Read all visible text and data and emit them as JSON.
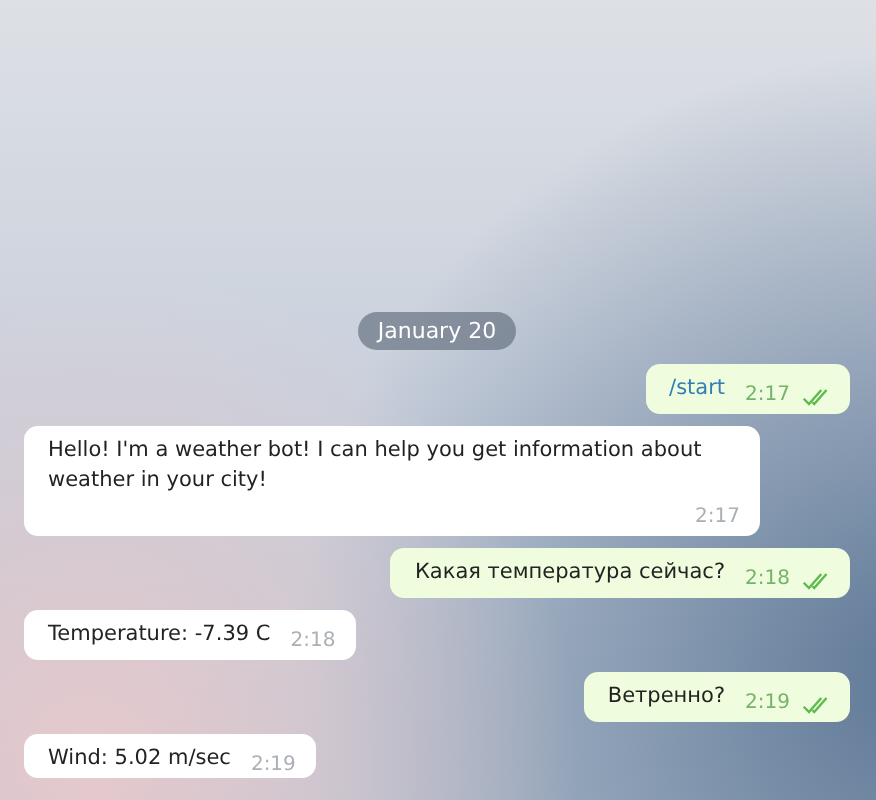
{
  "date_label": "January 20",
  "messages": [
    {
      "outgoing": true,
      "kind": "command",
      "text": "/start",
      "time": "2:17",
      "read": true
    },
    {
      "outgoing": false,
      "kind": "text",
      "text": "Hello! I'm a weather bot! I can help you get information about weather in your city!",
      "time": "2:17"
    },
    {
      "outgoing": true,
      "kind": "text",
      "text": "Какая температура сейчас?",
      "time": "2:18",
      "read": true
    },
    {
      "outgoing": false,
      "kind": "text",
      "text": "Temperature: -7.39 C",
      "time": "2:18"
    },
    {
      "outgoing": true,
      "kind": "text",
      "text": "Ветренно?",
      "time": "2:19",
      "read": true
    },
    {
      "outgoing": false,
      "kind": "text",
      "text": "Wind: 5.02 m/sec",
      "time": "2:19"
    }
  ]
}
